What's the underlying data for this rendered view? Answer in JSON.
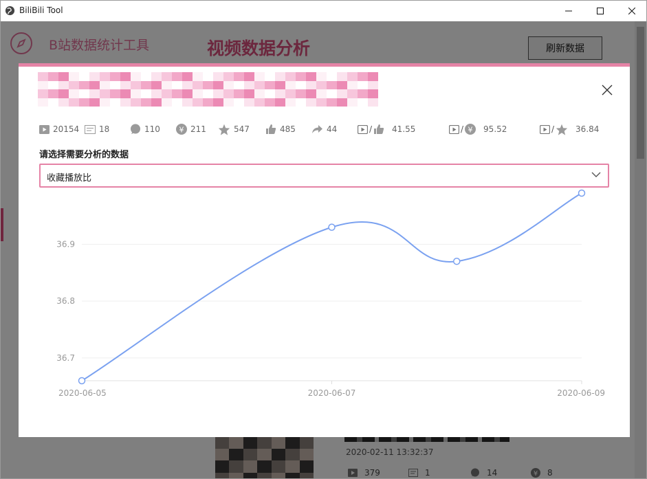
{
  "window": {
    "title": "BiliBili Tool"
  },
  "app": {
    "logo_text": "B站数据统计工具",
    "page_title": "视频数据分析",
    "refresh_label": "刷新数据",
    "bg_video": {
      "date": "2020-02-11 13:32:37",
      "stats": {
        "play": "379",
        "danmaku": "1",
        "comment": "14",
        "coin": "8"
      }
    }
  },
  "modal": {
    "stats": {
      "play": "20154",
      "danmaku": "18",
      "comment": "110",
      "coin": "211",
      "favorite": "547",
      "like": "485",
      "share": "44",
      "play_like_ratio": "41.55",
      "play_coin_ratio": "95.52",
      "play_favorite_ratio": "36.84"
    },
    "select_label": "请选择需要分析的数据",
    "select_value": "收藏播放比",
    "accent_color": "#e583a6"
  },
  "chart_data": {
    "type": "line",
    "x": [
      "2020-06-05",
      "2020-06-07",
      "2020-06-08",
      "2020-06-09"
    ],
    "x_tick_labels": [
      "2020-06-05",
      "2020-06-07",
      "2020-06-09"
    ],
    "values": [
      36.66,
      36.93,
      36.87,
      36.99
    ],
    "y_tick_labels": [
      "36.7",
      "36.8",
      "36.9"
    ],
    "ylim": [
      36.66,
      36.99
    ],
    "smooth": true,
    "line_color": "#7aa1f0",
    "grid": true
  }
}
